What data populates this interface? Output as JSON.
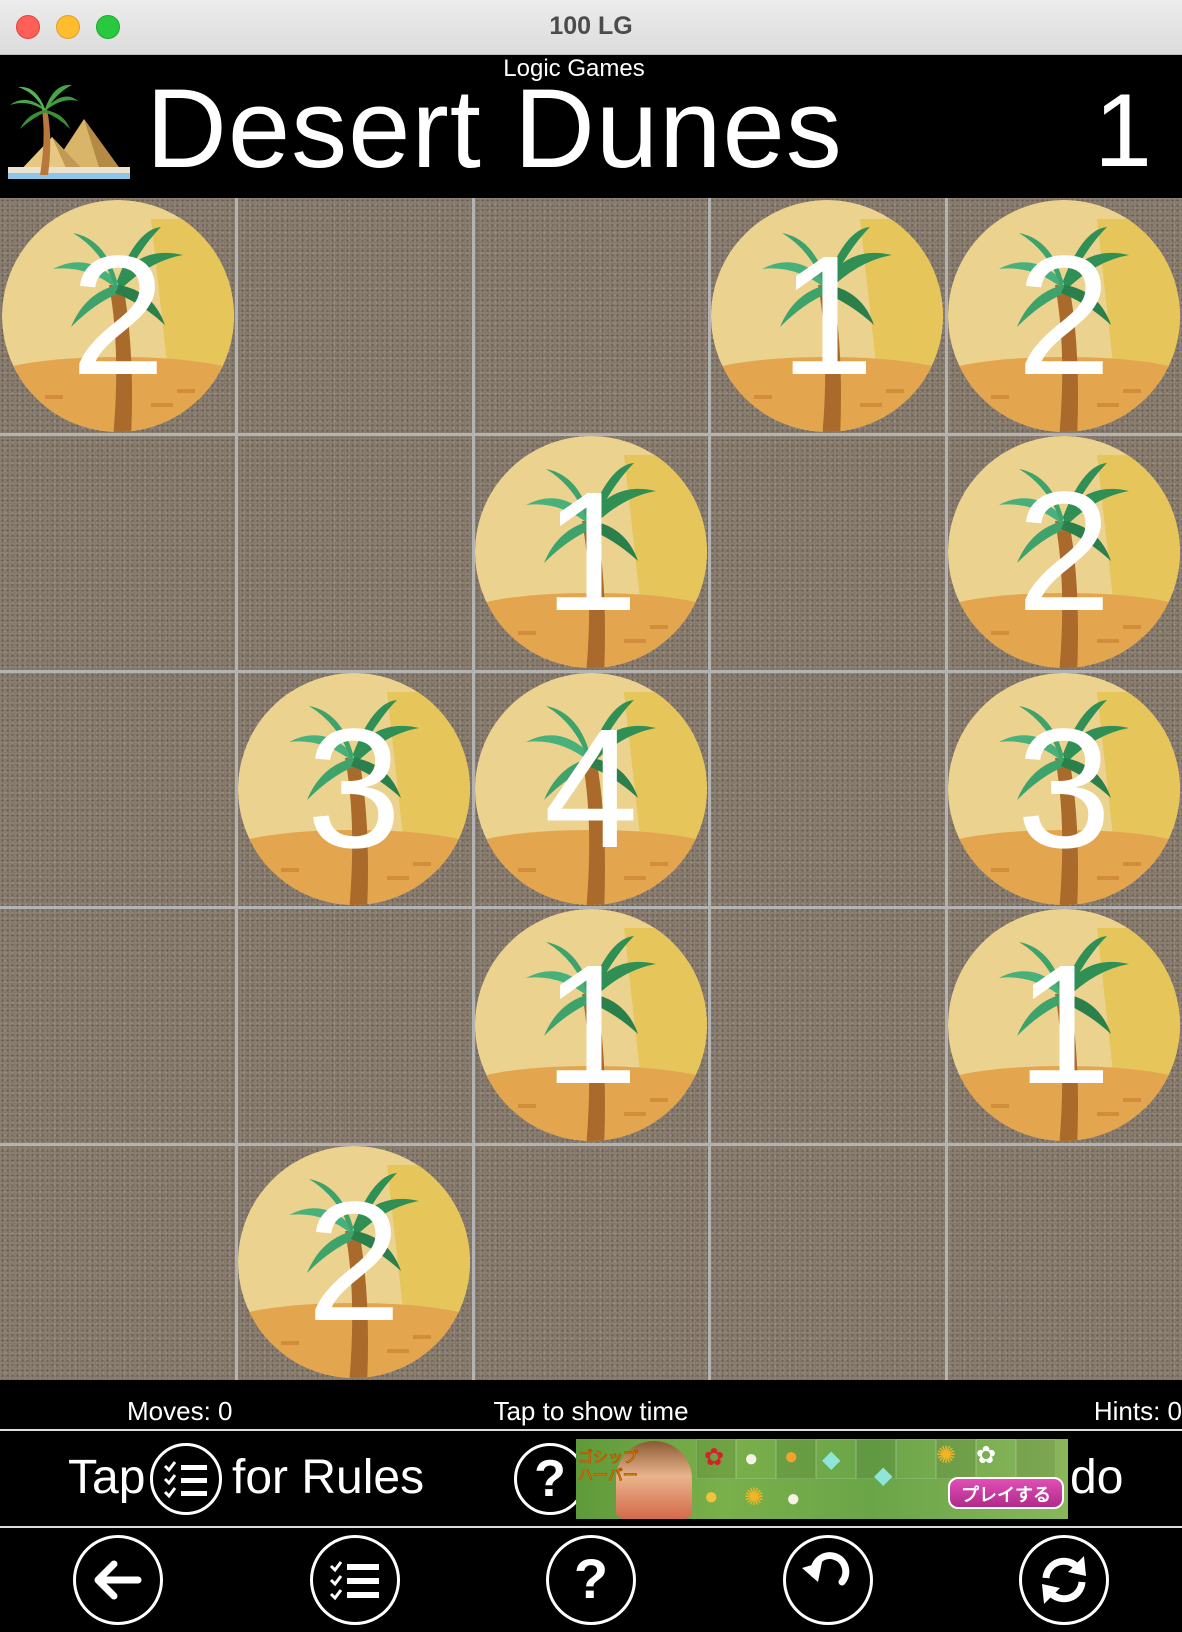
{
  "window": {
    "title": "100 LG"
  },
  "header": {
    "subtitle": "Logic Games",
    "title": "Desert Dunes",
    "level": "1",
    "logo_icon": "palm-desert-icon"
  },
  "board": {
    "rows": 5,
    "cols": 5,
    "clues": [
      {
        "row": 0,
        "col": 0,
        "value": "2"
      },
      {
        "row": 0,
        "col": 3,
        "value": "1"
      },
      {
        "row": 0,
        "col": 4,
        "value": "2"
      },
      {
        "row": 1,
        "col": 2,
        "value": "1"
      },
      {
        "row": 1,
        "col": 4,
        "value": "2"
      },
      {
        "row": 2,
        "col": 1,
        "value": "3"
      },
      {
        "row": 2,
        "col": 2,
        "value": "4"
      },
      {
        "row": 2,
        "col": 4,
        "value": "3"
      },
      {
        "row": 3,
        "col": 2,
        "value": "1"
      },
      {
        "row": 3,
        "col": 4,
        "value": "1"
      },
      {
        "row": 4,
        "col": 1,
        "value": "2"
      }
    ],
    "colors": {
      "sand": "#8e8173",
      "grid": "#b3b3b3",
      "circle": "#e9cd86",
      "leaf": "#3d9a5b",
      "trunk": "#a96a2b"
    }
  },
  "status": {
    "moves": "Moves: 0",
    "timer": "Tap to show time",
    "hints": "Hints: 0"
  },
  "banner": {
    "tap_text": "Tap",
    "rules_text": "for Rules",
    "trailing_text": "do",
    "ad": {
      "logo": "ゴシップ ハーバー",
      "button": "プレイする"
    }
  },
  "toolbar": {
    "buttons": [
      {
        "icon": "back-arrow-icon"
      },
      {
        "icon": "rules-list-icon"
      },
      {
        "icon": "help-icon"
      },
      {
        "icon": "undo-icon"
      },
      {
        "icon": "restart-icon"
      }
    ]
  }
}
